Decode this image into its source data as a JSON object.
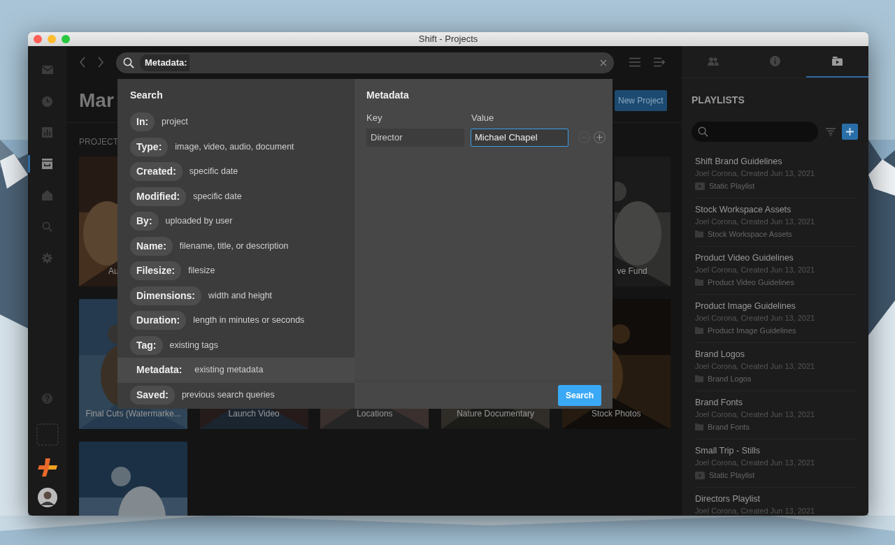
{
  "window": {
    "title": "Shift - Projects"
  },
  "rail": {
    "items": [
      {
        "selected": false
      },
      {
        "selected": false
      },
      {
        "selected": false
      },
      {
        "selected": true
      },
      {
        "selected": false
      },
      {
        "selected": false
      },
      {
        "selected": false
      }
    ]
  },
  "search_bar": {
    "token": "Metadata:"
  },
  "page": {
    "heading": "Mar",
    "new_project_button": "New Project",
    "section_label": "PROJECT"
  },
  "projects": {
    "rows": [
      [
        {
          "label": "Au"
        },
        null,
        null,
        null,
        {
          "label": "ve Fund"
        }
      ],
      [
        {
          "label": "Final Cuts (Watermarke..."
        },
        {
          "label": "Launch Video"
        },
        {
          "label": "Locations"
        },
        {
          "label": "Nature Documentary"
        },
        {
          "label": "Stock Photos"
        }
      ],
      [
        {}
      ]
    ]
  },
  "search_menu": {
    "title": "Search",
    "filters": [
      {
        "label": "In:",
        "hint": "project",
        "selected": false
      },
      {
        "label": "Type:",
        "hint": "image, video, audio, document",
        "selected": false
      },
      {
        "label": "Created:",
        "hint": "specific date",
        "selected": false
      },
      {
        "label": "Modified:",
        "hint": "specific date",
        "selected": false
      },
      {
        "label": "By:",
        "hint": "uploaded by user",
        "selected": false
      },
      {
        "label": "Name:",
        "hint": "filename, title, or description",
        "selected": false
      },
      {
        "label": "Filesize:",
        "hint": "filesize",
        "selected": false
      },
      {
        "label": "Dimensions:",
        "hint": "width and height",
        "selected": false
      },
      {
        "label": "Duration:",
        "hint": "length in minutes or seconds",
        "selected": false
      },
      {
        "label": "Tag:",
        "hint": "existing tags",
        "selected": false
      },
      {
        "label": "Metadata:",
        "hint": "existing metadata",
        "selected": true
      },
      {
        "label": "Saved:",
        "hint": "previous search queries",
        "selected": false
      }
    ],
    "metadata": {
      "title": "Metadata",
      "key_label": "Key",
      "value_label": "Value",
      "key": {
        "value": "Director",
        "focused": false
      },
      "value": {
        "value": "Michael Chapel",
        "focused": true
      },
      "remove_disabled": true
    },
    "search_button": "Search"
  },
  "right_panel": {
    "tabs": [
      {
        "selected": false
      },
      {
        "selected": false
      },
      {
        "selected": true
      }
    ],
    "title": "PLAYLISTS",
    "playlists": [
      {
        "title": "Shift Brand Guidelines",
        "meta": "Joel Corona, Created Jun 13, 2021",
        "kind": "static",
        "type": "Static Playlist"
      },
      {
        "title": "Stock Workspace Assets",
        "meta": "Joel Corona, Created Jun 13, 2021",
        "kind": "folder",
        "type": "Stock Workspace Assets"
      },
      {
        "title": "Product Video Guidelines",
        "meta": "Joel Corona, Created Jun 13, 2021",
        "kind": "folder",
        "type": "Product Video Guidelines"
      },
      {
        "title": "Product Image Guidelines",
        "meta": "Joel Corona, Created Jun 13, 2021",
        "kind": "folder",
        "type": "Product Image Guidelines"
      },
      {
        "title": "Brand Logos",
        "meta": "Joel Corona, Created Jun 13, 2021",
        "kind": "folder",
        "type": "Brand Logos"
      },
      {
        "title": "Brand Fonts",
        "meta": "Joel Corona, Created Jun 13, 2021",
        "kind": "folder",
        "type": "Brand Fonts"
      },
      {
        "title": "Small Trip - Stills",
        "meta": "Joel Corona, Created Jun 13, 2021",
        "kind": "static",
        "type": "Static Playlist"
      },
      {
        "title": "Directors Playlist",
        "meta": "Joel Corona, Created Jun 13, 2021"
      }
    ]
  }
}
